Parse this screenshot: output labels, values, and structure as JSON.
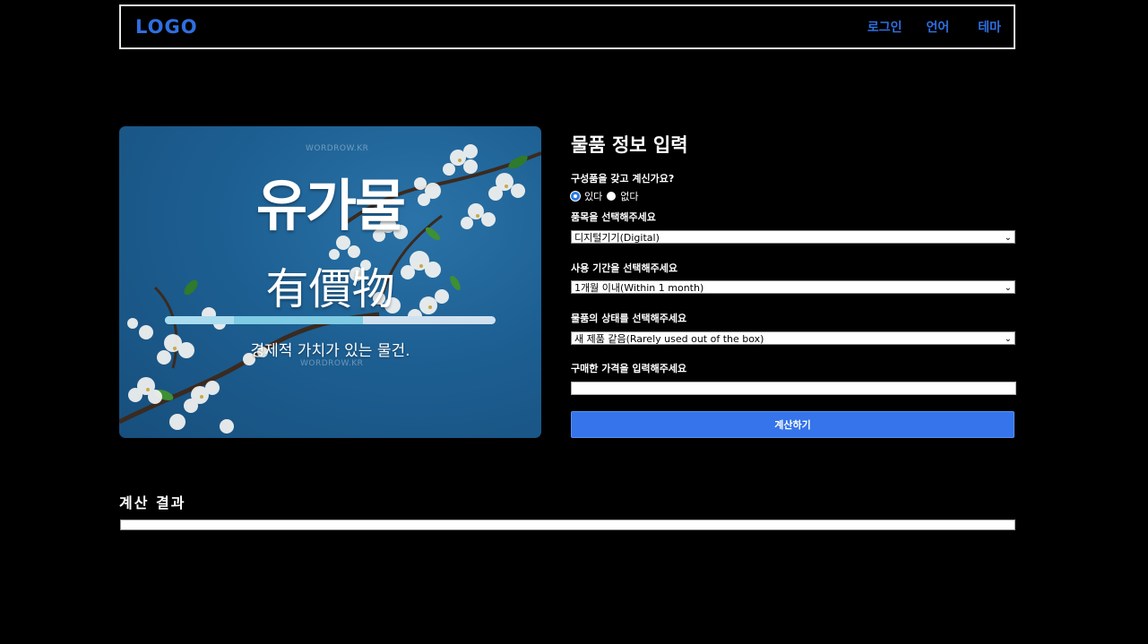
{
  "header": {
    "logo": "LOGO",
    "nav": {
      "login": "로그인",
      "language": "언어",
      "theme": "테마"
    },
    "accent_color": "#2f6fe0"
  },
  "hero": {
    "watermark_top": "WORDROW.KR",
    "title": "유가물",
    "hanja": "有價物",
    "subtitle": "경제적 가치가 있는 물건.",
    "watermark_bottom": "WORDROW.KR",
    "background_color": "#1d5f92"
  },
  "form": {
    "title": "물품 정보 입력",
    "components_question": "구성품을 갖고 계신가요?",
    "radio_yes": "있다",
    "radio_no": "없다",
    "radio_selected": "있다",
    "category_label": "품목을 선택해주세요",
    "category_value": "디지털기기(Digital)",
    "period_label": "사용 기간을 선택해주세요",
    "period_value": "1개월 이내(Within 1 month)",
    "condition_label": "물품의 상태를 선택해주세요",
    "condition_value": "새 제품 같음(Rarely used out of the box)",
    "price_label": "구매한 가격을 입력해주세요",
    "price_value": "",
    "submit_label": "계산하기",
    "button_color": "#3574ea"
  },
  "result": {
    "title": "계산 결과",
    "value": ""
  }
}
